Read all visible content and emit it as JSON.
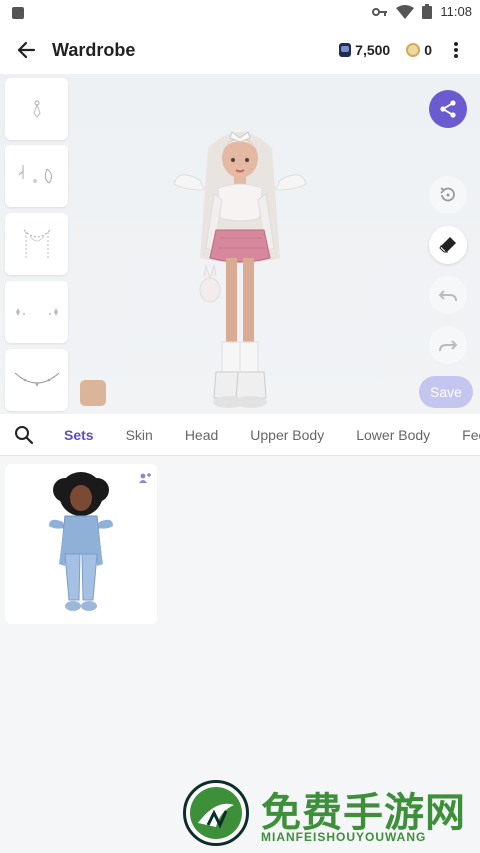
{
  "status_bar": {
    "time": "11:08"
  },
  "app_bar": {
    "title": "Wardrobe",
    "gems": "7,500",
    "coins": "0"
  },
  "editor": {
    "save_label": "Save",
    "skin_swatch_color": "#dbb59a",
    "accent_color": "#6a5bd1"
  },
  "tabs": [
    "Sets",
    "Skin",
    "Head",
    "Upper Body",
    "Lower Body",
    "Fee"
  ],
  "active_tab": "Sets",
  "watermark": {
    "title": "免费手游网",
    "subtitle": "MIANFEISHOUYOUWANG"
  }
}
